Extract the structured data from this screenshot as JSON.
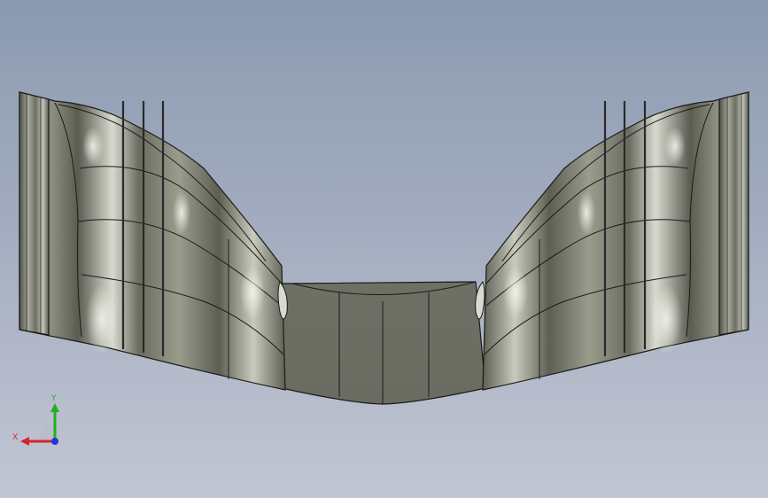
{
  "viewport": {
    "background_top": "#8b9ab0",
    "background_bottom": "#c2c6d3"
  },
  "model": {
    "surface_color": "#6b6d62",
    "highlight_color": "#e8e9e0",
    "edge_color": "#1a1a1a"
  },
  "triad": {
    "x_label": "X",
    "y_label": "Y",
    "x_color": "#d8222a",
    "y_color": "#22b022",
    "z_color": "#2233d8"
  }
}
